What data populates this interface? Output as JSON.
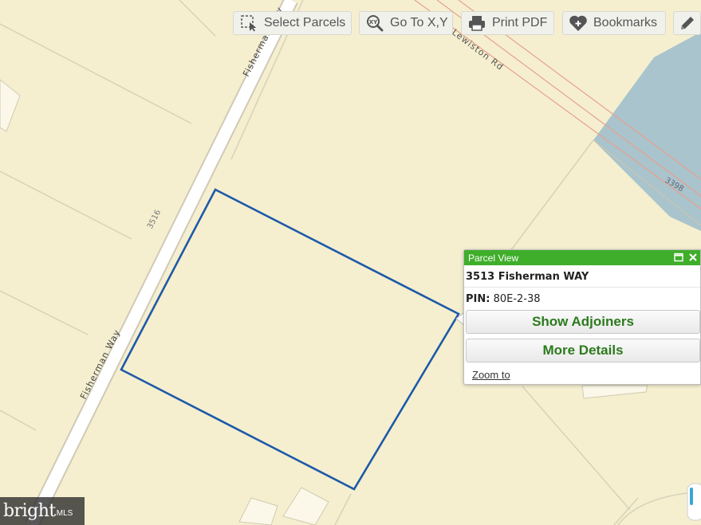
{
  "toolbar": {
    "select_parcels": "Select Parcels",
    "go_to_xy": "Go To X,Y",
    "print_pdf": "Print PDF",
    "bookmarks": "Bookmarks"
  },
  "map": {
    "road_fisherman_upper": "Fisherman Way",
    "road_fisherman_lower": "Fisherman Way",
    "road_lewiston": "Lewiston Rd",
    "parcel_3516": "3516",
    "parcel_3398": "3398"
  },
  "popup": {
    "title": "Parcel View",
    "address": "3513 Fisherman WAY",
    "pin_label": "PIN:",
    "pin_value": "80E-2-38",
    "show_adjoiners": "Show Adjoiners",
    "more_details": "More Details",
    "zoom_to": "Zoom to"
  },
  "watermark": {
    "brand": "bright",
    "suffix": "MLS"
  },
  "colors": {
    "map_background": "#f5efd0",
    "selected_parcel_outline": "#1e5aa8",
    "water": "#a9c4cc",
    "popup_header": "#3fae2a",
    "button_text": "#2c7a1d"
  }
}
